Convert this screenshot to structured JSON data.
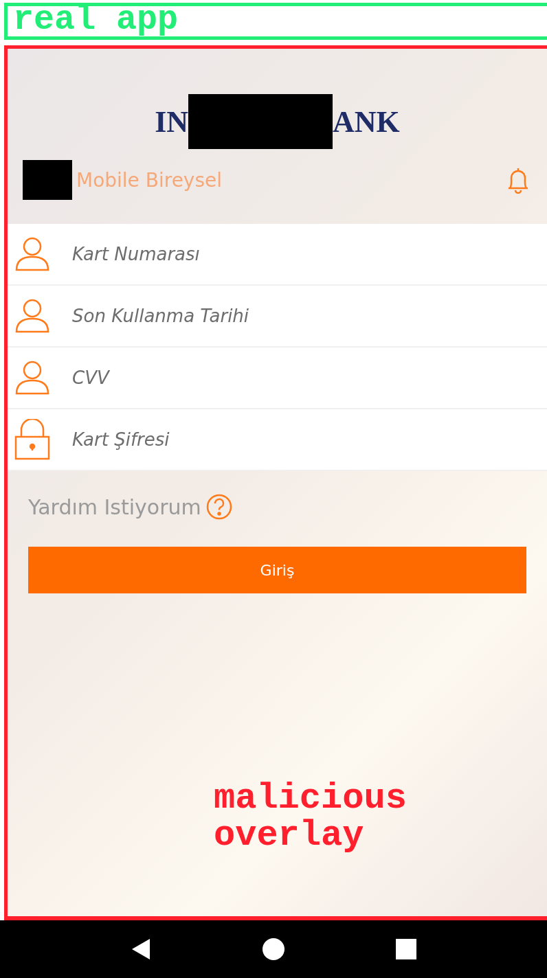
{
  "annotations": {
    "top_label": "real app",
    "bottom_label": "malicious overlay"
  },
  "header": {
    "logo_left": "IN",
    "logo_right": "ANK",
    "subtitle": "Mobile Bireysel"
  },
  "fields": [
    {
      "kind": "person",
      "placeholder": "Kart Numarası"
    },
    {
      "kind": "person",
      "placeholder": "Son Kullanma Tarihi"
    },
    {
      "kind": "person",
      "placeholder": "CVV"
    },
    {
      "kind": "lock",
      "placeholder": "Kart Şifresi"
    }
  ],
  "help": {
    "label": "Yardım Istiyorum"
  },
  "login_button": {
    "label": "Giriş"
  }
}
